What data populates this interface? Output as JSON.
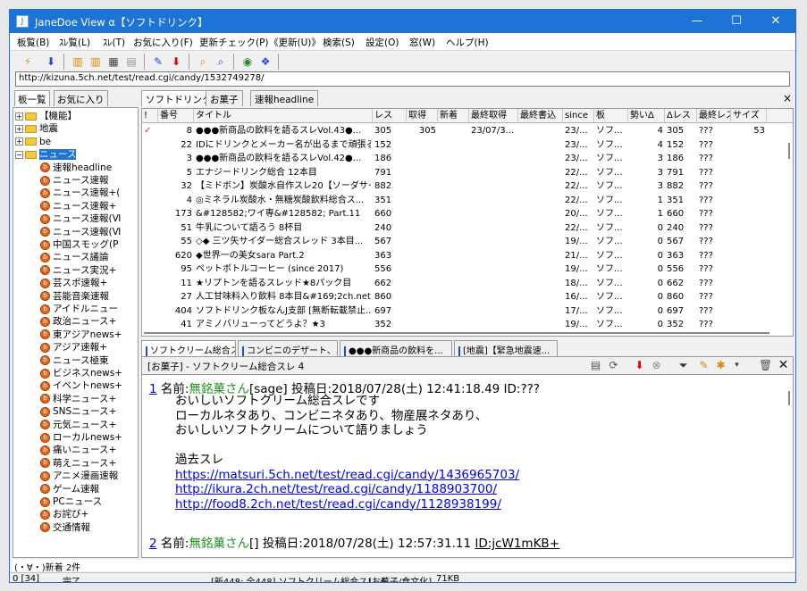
{
  "window": {
    "title": "JaneDoe View α【ソフトドリンク】",
    "min": "—",
    "max": "☐",
    "close": "✕"
  },
  "menu": [
    "板覧(B)",
    "ｽﾚ覧(L)",
    "ｽﾚ(T)",
    "お気に入り(F)",
    "更新チェック(P)",
    "《更新(U)》",
    "検索(S)",
    "設定(O)",
    "窓(W)",
    "ヘルプ(H)"
  ],
  "address": "http://kizuna.5ch.net/test/read.cgi/candy/1532749278/",
  "left": {
    "tabs": [
      "板一覧",
      "お気に入り"
    ],
    "folders": [
      {
        "label": "【機能】",
        "exp": "+"
      },
      {
        "label": "地震",
        "exp": "+"
      },
      {
        "label": "be",
        "exp": "+"
      },
      {
        "label": "ニュース",
        "exp": "−"
      }
    ],
    "boards": [
      "速報headline",
      "ニュース速報",
      "ニュース速報+(",
      "ニュース速報+",
      "ニュース速報(Ⅵ",
      "ニュース速報(Ⅵ",
      "中国スモッグ(P",
      "ニュース議論",
      "ニュース実況+",
      "芸スポ速報+",
      "芸能音楽速報",
      "アイドルニュー",
      "政治ニュース+",
      "東アジアnews+",
      "アジア速報+",
      "ニュース極東",
      "ビジネスnews+",
      "イベントnews+",
      "科学ニュース+",
      "SNSニュース+",
      "元気ニュース+",
      "ローカルnews+",
      "痛いニュース+",
      "萌えニュース+",
      "アニメ漫画速報",
      "ゲーム速報",
      "PCニュース",
      "お詫び+",
      "交通情報"
    ]
  },
  "boardtabs": [
    "ソフトドリンク",
    "お菓子",
    "速報headline"
  ],
  "close_tab": "×",
  "columns": [
    "!",
    "番号",
    "タイトル",
    "レス",
    "取得",
    "新着",
    "最終取得",
    "最終書込",
    "since",
    "板",
    "勢いΔ",
    "Δレス",
    "最終レス",
    "サイズ"
  ],
  "rows": [
    {
      "mark": "✓",
      "num": "8",
      "title": "●●●新商品の飲料を語るスレVol.43●...",
      "res": "305",
      "got": "305",
      "newc": "",
      "last": "23/07/3...",
      "lastw": "",
      "since": "23/...",
      "board": "ソフ...",
      "ikioi": "4",
      "dres": "305",
      "lres": "???",
      "size": "53"
    },
    {
      "mark": "",
      "num": "22",
      "title": "IDにドリンクとメーカー名が出るまで頑張るス...",
      "res": "152",
      "got": "",
      "newc": "",
      "last": "",
      "lastw": "",
      "since": "23/...",
      "board": "ソフ...",
      "ikioi": "4",
      "dres": "152",
      "lres": "???",
      "size": ""
    },
    {
      "mark": "",
      "num": "3",
      "title": "●●●新商品の飲料を語るスレVol.42●...",
      "res": "186",
      "got": "",
      "newc": "",
      "last": "",
      "lastw": "",
      "since": "23/...",
      "board": "ソフ...",
      "ikioi": "3",
      "dres": "186",
      "lres": "???",
      "size": ""
    },
    {
      "mark": "",
      "num": "5",
      "title": "エナジードリンク総合 12本目",
      "res": "791",
      "got": "",
      "newc": "",
      "last": "",
      "lastw": "",
      "since": "22/...",
      "board": "ソフ...",
      "ikioi": "3",
      "dres": "791",
      "lres": "???",
      "size": ""
    },
    {
      "mark": "",
      "num": "32",
      "title": "【ミドボン】炭酸水自作スレ20【ソーダサイフ...",
      "res": "882",
      "got": "",
      "newc": "",
      "last": "",
      "lastw": "",
      "since": "22/...",
      "board": "ソフ...",
      "ikioi": "3",
      "dres": "882",
      "lres": "???",
      "size": ""
    },
    {
      "mark": "",
      "num": "4",
      "title": "◎ミネラル炭酸水・無糖炭酸飲料総合ス...",
      "res": "351",
      "got": "",
      "newc": "",
      "last": "",
      "lastw": "",
      "since": "22/...",
      "board": "ソフ...",
      "ikioi": "1",
      "dres": "351",
      "lres": "???",
      "size": ""
    },
    {
      "mark": "",
      "num": "173",
      "title": "&#128582;ワイ専&#128582;  Part.11",
      "res": "660",
      "got": "",
      "newc": "",
      "last": "",
      "lastw": "",
      "since": "20/...",
      "board": "ソフ...",
      "ikioi": "1",
      "dres": "660",
      "lres": "???",
      "size": ""
    },
    {
      "mark": "",
      "num": "51",
      "title": "牛乳について語ろう 8杯目",
      "res": "240",
      "got": "",
      "newc": "",
      "last": "",
      "lastw": "",
      "since": "22/...",
      "board": "ソフ...",
      "ikioi": "0",
      "dres": "240",
      "lres": "???",
      "size": ""
    },
    {
      "mark": "",
      "num": "55",
      "title": "◇◆  三ツ矢サイダー総合スレッド  3本目...",
      "res": "567",
      "got": "",
      "newc": "",
      "last": "",
      "lastw": "",
      "since": "19/...",
      "board": "ソフ...",
      "ikioi": "0",
      "dres": "567",
      "lres": "???",
      "size": ""
    },
    {
      "mark": "",
      "num": "620",
      "title": "◆世界一の美女sara  Part.2",
      "res": "363",
      "got": "",
      "newc": "",
      "last": "",
      "lastw": "",
      "since": "21/...",
      "board": "ソフ...",
      "ikioi": "0",
      "dres": "363",
      "lres": "???",
      "size": ""
    },
    {
      "mark": "",
      "num": "95",
      "title": "ペットボトルコーヒー (since 2017)",
      "res": "556",
      "got": "",
      "newc": "",
      "last": "",
      "lastw": "",
      "since": "19/...",
      "board": "ソフ...",
      "ikioi": "0",
      "dres": "556",
      "lres": "???",
      "size": ""
    },
    {
      "mark": "",
      "num": "11",
      "title": "★リプトンを語るスレッド★8パック目",
      "res": "662",
      "got": "",
      "newc": "",
      "last": "",
      "lastw": "",
      "since": "18/...",
      "board": "ソフ...",
      "ikioi": "0",
      "dres": "662",
      "lres": "???",
      "size": ""
    },
    {
      "mark": "",
      "num": "27",
      "title": "人工甘味料入り飲料 8本目&#169;2ch.net",
      "res": "860",
      "got": "",
      "newc": "",
      "last": "",
      "lastw": "",
      "since": "16/...",
      "board": "ソフ...",
      "ikioi": "0",
      "dres": "860",
      "lres": "???",
      "size": ""
    },
    {
      "mark": "",
      "num": "404",
      "title": "ソフトドリンク板なんJ支部 [無断転載禁止...",
      "res": "697",
      "got": "",
      "newc": "",
      "last": "",
      "lastw": "",
      "since": "17/...",
      "board": "ソフ...",
      "ikioi": "0",
      "dres": "697",
      "lres": "???",
      "size": ""
    },
    {
      "mark": "",
      "num": "41",
      "title": "アミノバリューってどうよ？★3",
      "res": "352",
      "got": "",
      "newc": "",
      "last": "",
      "lastw": "",
      "since": "19/...",
      "board": "ソフ...",
      "ikioi": "0",
      "dres": "352",
      "lres": "???",
      "size": ""
    }
  ],
  "threadtabs": [
    "ソフトクリーム総合ス...",
    "コンビニのデザート、...",
    "●●●新商品の飲料を...",
    "[地震]【緊急地震速..."
  ],
  "threadtitle": "[お菓子] - ソフトクリーム総合スレ 4",
  "posts": [
    {
      "num": "1",
      "label": "名前:",
      "name": "無銘菓さん",
      "mail": "[sage]",
      "meta": "投稿日:2018/07/28(土) 12:41:18.49 ID:???",
      "lines": [
        "おいしいソフトクリーム総合スレです",
        "ローカルネタあり、コンビニネタあり、物産展ネタあり、",
        "おいしいソフトクリームについて語りましょう",
        "",
        "過去スレ"
      ],
      "links": [
        "https://matsuri.5ch.net/test/read.cgi/candy/1436965703/",
        "http://ikura.2ch.net/test/read.cgi/candy/1188903700/",
        "http://food8.2ch.net/test/read.cgi/candy/1128938199/"
      ]
    },
    {
      "num": "2",
      "label": "名前:",
      "name": "無銘菓さん",
      "mail": "[]",
      "meta": "投稿日:2018/07/28(土) 12:57:31.11",
      "id": "ID:jcW1mKB+"
    }
  ],
  "status1": "(・∀・)新着 2件",
  "status2": {
    "a": "0 [34]",
    "b": "完了",
    "c": "[新448: 全448] ソフトクリーム総合スレ 4",
    "d": "[お菓子/食文化]",
    "e": "71KB"
  }
}
